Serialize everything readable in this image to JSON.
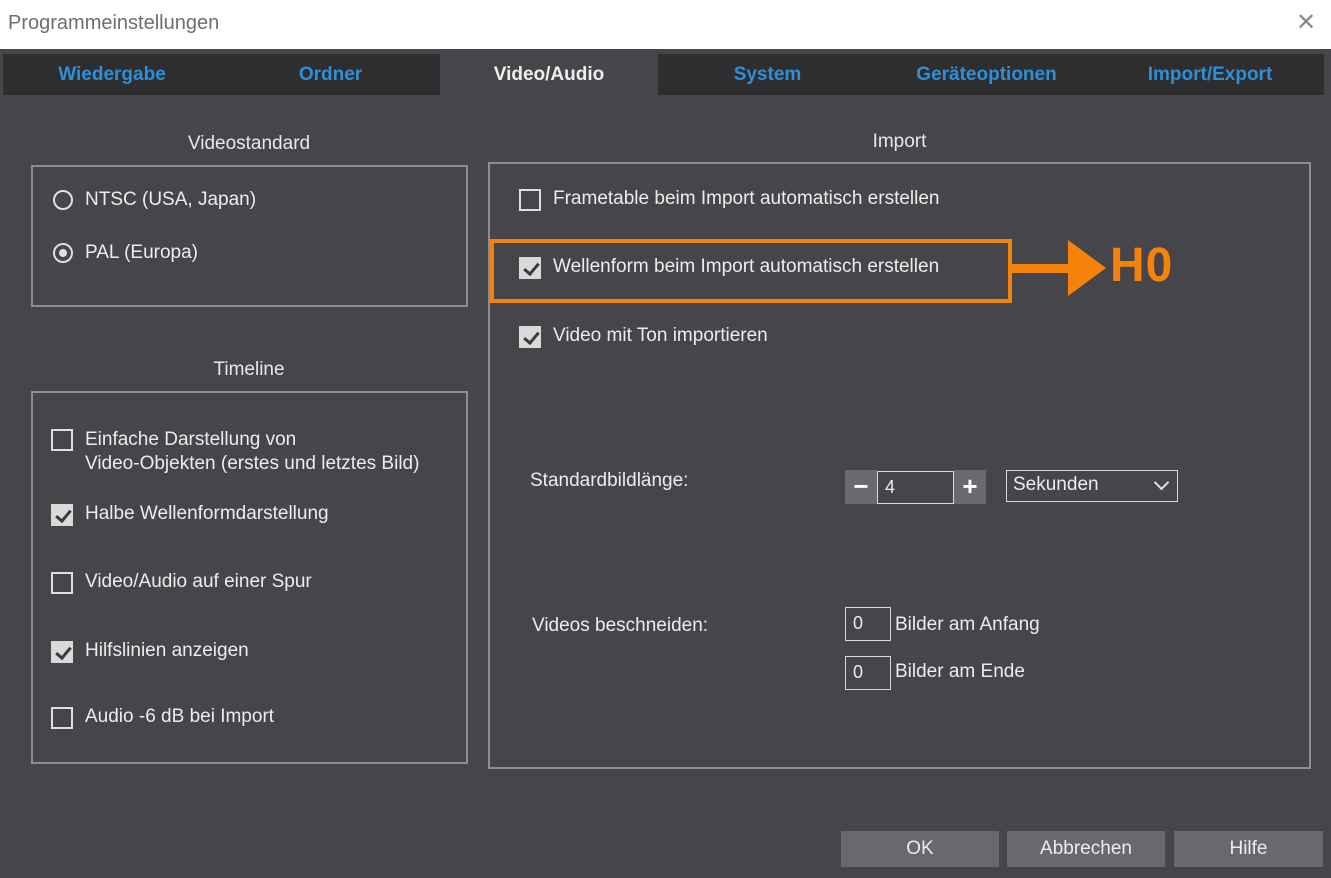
{
  "window": {
    "title": "Programmeinstellungen"
  },
  "tabs": [
    {
      "label": "Wiedergabe"
    },
    {
      "label": "Ordner"
    },
    {
      "label": "Video/Audio"
    },
    {
      "label": "System"
    },
    {
      "label": "Geräteoptionen"
    },
    {
      "label": "Import/Export"
    }
  ],
  "active_tab": "Video/Audio",
  "videostandard": {
    "title": "Videostandard",
    "options": [
      {
        "label": "NTSC (USA, Japan)",
        "selected": false
      },
      {
        "label": "PAL (Europa)",
        "selected": true
      }
    ]
  },
  "timeline": {
    "title": "Timeline",
    "options": [
      {
        "line1": "Einfache Darstellung von",
        "line2": "Video-Objekten (erstes und letztes Bild)",
        "checked": false
      },
      {
        "label": "Halbe Wellenformdarstellung",
        "checked": true
      },
      {
        "label": "Video/Audio auf einer Spur",
        "checked": false
      },
      {
        "label": "Hilfslinien anzeigen",
        "checked": true
      },
      {
        "label": "Audio -6 dB bei Import",
        "checked": false
      }
    ]
  },
  "import": {
    "title": "Import",
    "options": [
      {
        "label": "Frametable beim Import automatisch erstellen",
        "checked": false
      },
      {
        "label": "Wellenform beim Import automatisch erstellen",
        "checked": true
      },
      {
        "label": "Video mit Ton importieren",
        "checked": true
      }
    ],
    "standard_length": {
      "label": "Standardbildlänge:",
      "minus": "−",
      "plus": "+",
      "value": "4",
      "unit": "Sekunden"
    },
    "trim": {
      "label": "Videos beschneiden:",
      "start_value": "0",
      "start_label": "Bilder am Anfang",
      "end_value": "0",
      "end_label": "Bilder am Ende"
    }
  },
  "annotation": {
    "tag": "H0",
    "color": "#f5820a"
  },
  "buttons": {
    "ok": "OK",
    "cancel": "Abbrechen",
    "help": "Hilfe"
  }
}
